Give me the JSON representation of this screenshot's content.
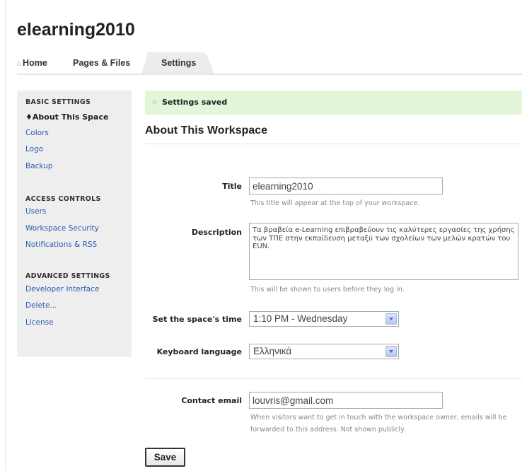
{
  "site": {
    "title": "elearning2010"
  },
  "tabs": {
    "home": "Home",
    "pages": "Pages & Files",
    "settings": "Settings"
  },
  "sidebar": {
    "basic_heading": "BASIC SETTINGS",
    "basic_items": [
      "About This Space",
      "Colors",
      "Logo",
      "Backup"
    ],
    "access_heading": "ACCESS CONTROLS",
    "access_items": [
      "Users",
      "Workspace Security",
      "Notifications & RSS"
    ],
    "advanced_heading": "ADVANCED SETTINGS",
    "advanced_items": [
      "Developer Interface",
      "Delete...",
      "License"
    ],
    "active_item": "About This Space"
  },
  "notice": {
    "text": "Settings saved"
  },
  "section": {
    "title": "About This Workspace"
  },
  "form": {
    "title_label": "Title",
    "title_value": "elearning2010",
    "title_help": "This title will appear at the top of your workspace.",
    "description_label": "Description",
    "description_value": "Τα βραβεία e-Learning επιβραβεύουν τις καλύτερες εργασίες της χρήσης των ΤΠΕ στην εκπαίδευση μεταξύ των σχολείων των μελών κρατών του EUN.",
    "description_help": "This will be shown to users before they log in.",
    "time_label": "Set the space's time",
    "time_value": "1:10 PM - Wednesday",
    "keyboard_label": "Keyboard language",
    "keyboard_value": "Ελληνικά",
    "email_label": "Contact email",
    "email_value": "louvris@gmail.com",
    "email_help_line1": "When visitors want to get in touch with the workspace owner, emails will be",
    "email_help_line2": "forwarded to this address. Not shown publicly.",
    "save_label": "Save"
  },
  "icons": {
    "home": "house-icon",
    "select_arrow": "chevron-down-icon",
    "active_marker": "diamond-icon"
  },
  "colors": {
    "link": "#2a5db0",
    "notice_bg": "#e3f6d9",
    "sidebar_bg": "#eeeeee"
  }
}
